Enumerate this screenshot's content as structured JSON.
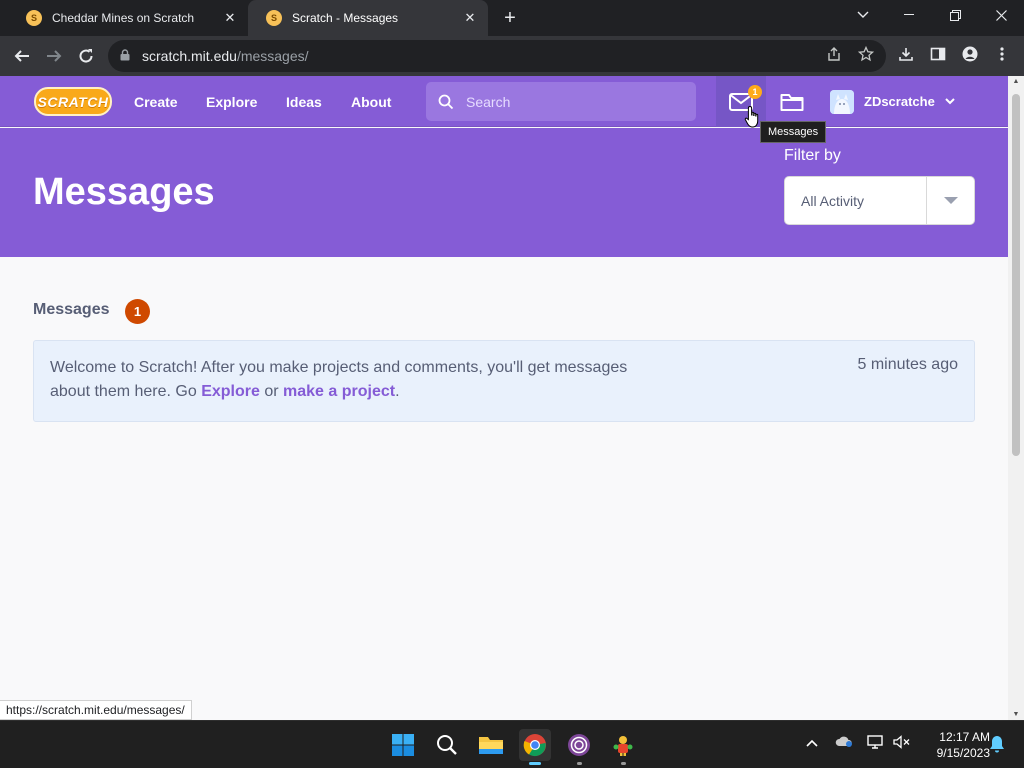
{
  "browser": {
    "tabs": [
      {
        "title": "Cheddar Mines on Scratch",
        "active": false
      },
      {
        "title": "Scratch - Messages",
        "active": true
      }
    ],
    "url_host": "scratch.mit.edu",
    "url_path": "/messages/",
    "status_url": "https://scratch.mit.edu/messages/"
  },
  "scratch": {
    "logo_text": "SCRATCH",
    "nav": [
      "Create",
      "Explore",
      "Ideas",
      "About"
    ],
    "search_placeholder": "Search",
    "messages_notification_count": "1",
    "tooltip": "Messages",
    "username": "ZDscratche"
  },
  "hero": {
    "title": "Messages",
    "filter_label": "Filter by",
    "filter_value": "All Activity"
  },
  "messages": {
    "section_title": "Messages",
    "count": "1",
    "items": [
      {
        "text_before": "Welcome to Scratch! After you make projects and comments, you'll get messages about them here. Go ",
        "link1": "Explore",
        "text_middle": " or ",
        "link2": "make a project",
        "text_after": ".",
        "time": "5 minutes ago"
      }
    ]
  },
  "taskbar": {
    "time": "12:17 AM",
    "date": "9/15/2023"
  },
  "colors": {
    "scratch_purple": "#855cd6",
    "badge_orange": "#cf4900",
    "notification_yellow": "#ffab1a",
    "card_bg": "#e9f1fc"
  }
}
